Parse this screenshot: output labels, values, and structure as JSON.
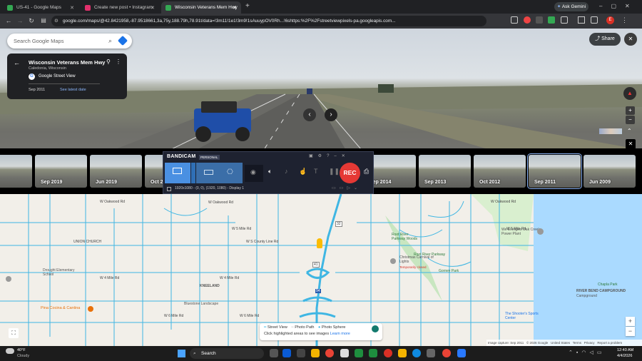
{
  "browser": {
    "tabs": [
      {
        "title": "US-41 - Google Maps",
        "favicon_color": "#34a853"
      },
      {
        "title": "Create new post • Instagram",
        "favicon_color": "#e1306c"
      },
      {
        "title": "Wisconsin Veterans Mem Hwy",
        "favicon_color": "#34a853"
      }
    ],
    "new_tab": "+",
    "ask_gemini": "Ask Gemini",
    "url": "google.com/maps/@42.8421958,-87.9518661,3a,75y,188.79h,78.91t/data=!3m11!1e1!3m9!1sAuuypOV0Rh...!6shttps:%2F%2Fstreetviewpixels-pa.googleapis.com..."
  },
  "streetview": {
    "search_placeholder": "Search Google Maps",
    "card": {
      "title": "Wisconsin Veterans Mem Hwy",
      "subtitle": "Caledonia, Wisconsin",
      "source": "Google Street View",
      "date": "Sep 2011",
      "see_latest": "See latest date"
    },
    "share_label": "Share",
    "zoom_in": "+",
    "zoom_out": "−"
  },
  "timeline": [
    {
      "label": ""
    },
    {
      "label": "Sep 2019"
    },
    {
      "label": "Jun 2019"
    },
    {
      "label": "Oct 2"
    },
    {
      "label": "Sep 2014"
    },
    {
      "label": "Sep 2013"
    },
    {
      "label": "Oct 2012"
    },
    {
      "label": "Sep 2011",
      "selected": true
    },
    {
      "label": "Jun 2009"
    }
  ],
  "bandicam": {
    "brand": "BANDICAM",
    "edition": "PERSONAL",
    "rec": "REC",
    "status": "1920x1080 - (0, 0), (1920, 1080) - Display 1"
  },
  "map": {
    "labels": [
      {
        "text": "W Oakwood Rd"
      },
      {
        "text": "W Oakwood Rd"
      },
      {
        "text": "W Oakwood Rd"
      },
      {
        "text": "UNION CHURCH"
      },
      {
        "text": "W 5 Mile Rd"
      },
      {
        "text": "W 5 Mile Rd"
      },
      {
        "text": "W S County Line Rd"
      },
      {
        "text": "W 4 Mile Rd"
      },
      {
        "text": "W 4 Mile Rd"
      },
      {
        "text": "Drought Elementary School"
      },
      {
        "text": "KNEELAND"
      },
      {
        "text": "Bluestone Landscape"
      },
      {
        "text": "W 6 Mile Rd"
      },
      {
        "text": "W 6 Mile Rd"
      },
      {
        "text": "Pina Cocina & Cantina"
      },
      {
        "text": "Root River Parkway Woods"
      },
      {
        "text": "Root River Parkway"
      },
      {
        "text": "Christmas Carnival of Lights"
      },
      {
        "text": "Temporarily closed"
      },
      {
        "text": "Gorney Park"
      },
      {
        "text": "We Energies Oak Creek Power Plant"
      },
      {
        "text": "The Shooter's Sports Center"
      },
      {
        "text": "Chapla Park"
      },
      {
        "text": "RIVER BEND CAMPGROUND"
      },
      {
        "text": "Campground"
      },
      {
        "text": "41"
      },
      {
        "text": "94"
      },
      {
        "text": "32"
      }
    ],
    "legend": {
      "street_view": "Street View",
      "photo_path": "Photo Path",
      "photo_sphere": "Photo Sphere",
      "hint": "Click highlighted areas to see images",
      "learn_more": "Learn more"
    },
    "footer": [
      "Image capture: Sep 2011",
      "© 2026 Google",
      "United States",
      "Terms",
      "Privacy",
      "Report a problem"
    ],
    "zoom_in": "+",
    "zoom_out": "−"
  },
  "taskbar": {
    "weather_temp": "40°F",
    "weather_desc": "Cloudy",
    "search": "Search",
    "time": "12:40 AM",
    "date": "4/4/2026"
  }
}
